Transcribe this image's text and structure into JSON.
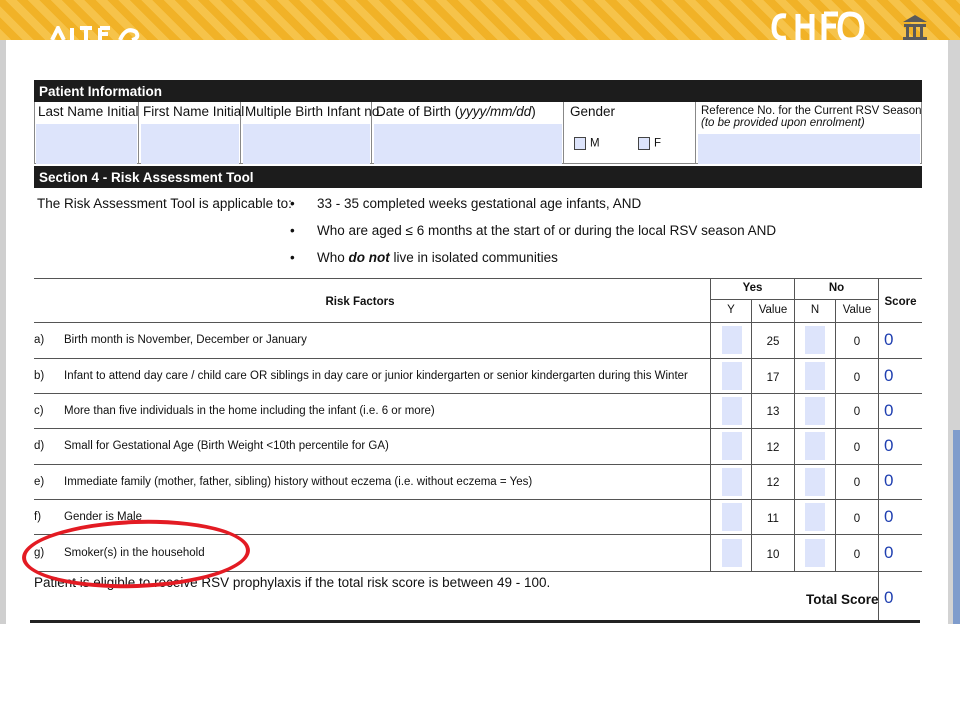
{
  "patient_info": {
    "header": "Patient Information",
    "columns": {
      "last_name": "Last Name Initial",
      "first_name": "First Name Initial",
      "multiple_birth": "Multiple Birth Infant no.",
      "dob_prefix": "Date of Birth (",
      "dob_format": "yyyy/mm/dd",
      "dob_suffix": ")",
      "gender": "Gender",
      "gender_m": "M",
      "gender_f": "F",
      "reference": "Reference No. for the Current RSV Season",
      "reference_note": "(to be provided upon enrolment)"
    }
  },
  "section4": {
    "header": "Section 4 - Risk Assessment Tool",
    "applicable_label": "The Risk Assessment Tool is applicable to:",
    "criteria": {
      "c1": "33 - 35 completed weeks gestational age infants, AND",
      "c2": "Who are aged ≤ 6 months at the start of or during the local RSV season AND",
      "c3_pre": "Who ",
      "c3_em": "do not",
      "c3_post": " live in isolated communities"
    },
    "bullet": "•"
  },
  "table": {
    "risk_factors_header": "Risk Factors",
    "yes_header": "Yes",
    "no_header": "No",
    "y": "Y",
    "n": "N",
    "value": "Value",
    "score_header": "Score",
    "rows": [
      {
        "letter": "a)",
        "text": "Birth month is November, December or January",
        "yes_value": "25",
        "no_value": "0",
        "score": "0"
      },
      {
        "letter": "b)",
        "text": "Infant to attend day care / child care OR siblings in day care or junior kindergarten or senior kindergarten during this Winter",
        "yes_value": "17",
        "no_value": "0",
        "score": "0"
      },
      {
        "letter": "c)",
        "text": "More than five individuals in the home including the infant (i.e. 6 or more)",
        "yes_value": "13",
        "no_value": "0",
        "score": "0"
      },
      {
        "letter": "d)",
        "text": "Small for Gestational Age (Birth Weight <10th percentile for GA)",
        "yes_value": "12",
        "no_value": "0",
        "score": "0"
      },
      {
        "letter": "e)",
        "text": "Immediate family (mother, father, sibling) history without eczema  (i.e. without eczema = Yes)",
        "yes_value": "12",
        "no_value": "0",
        "score": "0"
      },
      {
        "letter": "f)",
        "text": "Gender is Male",
        "yes_value": "11",
        "no_value": "0",
        "score": "0"
      },
      {
        "letter": "g)",
        "text": "Smoker(s) in the household",
        "yes_value": "10",
        "no_value": "0",
        "score": "0"
      }
    ],
    "eligibility_note": "Patient is eligible to receive RSV prophylaxis if the total risk score is between 49 - 100.",
    "total_label": "Total Score",
    "total_value": "0"
  },
  "colors": {
    "banner": "#f1b227",
    "header_bar": "#1c1c1c",
    "field_fill": "#dde4fb",
    "score_text": "#1f3fb0",
    "annotation_circle": "#e31b23"
  },
  "icons": [
    "building-icon",
    "logo-lettering"
  ]
}
